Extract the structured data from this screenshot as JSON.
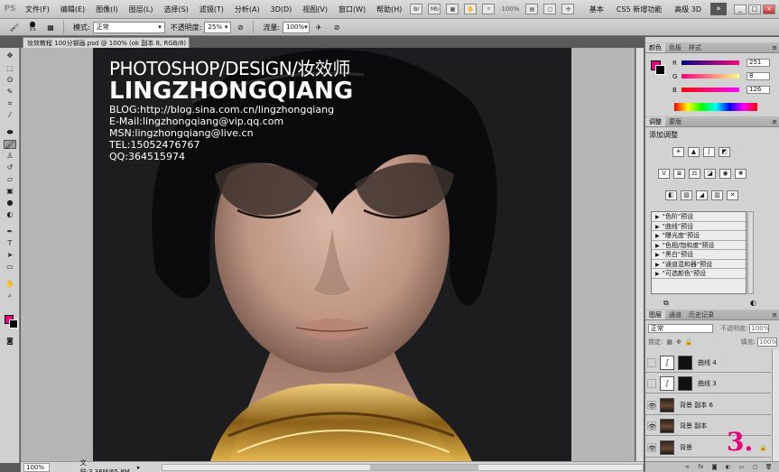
{
  "menubar": {
    "logo": "PS",
    "items": [
      "文件(F)",
      "编辑(E)",
      "图像(I)",
      "图层(L)",
      "选择(S)",
      "滤镜(T)",
      "分析(A)",
      "3D(D)",
      "视图(V)",
      "窗口(W)",
      "帮助(H)"
    ],
    "icon_labels": [
      "Br",
      "Mb"
    ],
    "zoom_readout": "100%",
    "workspaces": [
      "基本",
      "CS5 新增功能",
      "高级 3D"
    ],
    "more": "»"
  },
  "options": {
    "brush_size": "35",
    "mode_label": "模式:",
    "mode_value": "正常",
    "opacity_label": "不透明度:",
    "opacity_value": "25%",
    "flow_label": "流量:",
    "flow_value": "100%"
  },
  "document": {
    "tab_title": "妆效教程 100分钢画.psd @ 100% (ok 副本 8, RGB/8) *",
    "close": "×"
  },
  "watermark": {
    "line1": "PHOTOSHOP/DESIGN/妆效师",
    "line2": "LINGZHONGQIANG",
    "blog": "BLOG:http://blog.sina.com.cn/lingzhongqiang",
    "email": "E-Mail:lingzhongqiang@vip.qq.com",
    "msn": "MSN:lingzhongqiang@live.cn",
    "tel": "TEL:15052476767",
    "qq": "QQ:364515974"
  },
  "status": {
    "zoom": "100%",
    "doc_info": "文档:3.36M/65.8M"
  },
  "color_panel": {
    "tabs": [
      "颜色",
      "色板",
      "样式"
    ],
    "fg_color": "#e5007e",
    "bg_color": "#000000",
    "channels": [
      {
        "name": "R",
        "value": "251"
      },
      {
        "name": "G",
        "value": "8"
      },
      {
        "name": "B",
        "value": "126"
      }
    ]
  },
  "adjust_panel": {
    "tabs": [
      "调整",
      "蒙版"
    ],
    "title": "添加调整",
    "presets": [
      "\"色阶\"预设",
      "\"曲线\"预设",
      "\"曝光度\"预设",
      "\"色相/饱和度\"预设",
      "\"黑白\"预设",
      "\"通道混和器\"预设",
      "\"可选颜色\"预设"
    ]
  },
  "layers_panel": {
    "tabs": [
      "图层",
      "通道",
      "历史记录"
    ],
    "blend_mode": "正常",
    "opacity_label": "不透明度:",
    "opacity_value": "100%",
    "lock_label": "锁定:",
    "fill_label": "填充:",
    "fill_value": "100%",
    "layers": [
      {
        "name": "曲线 4",
        "visible": false
      },
      {
        "name": "曲线 3",
        "visible": false
      },
      {
        "name": "背景 副本 6",
        "visible": true
      },
      {
        "name": "背景 副本",
        "visible": true
      },
      {
        "name": "背景",
        "visible": true
      }
    ],
    "step_marker": "3."
  }
}
